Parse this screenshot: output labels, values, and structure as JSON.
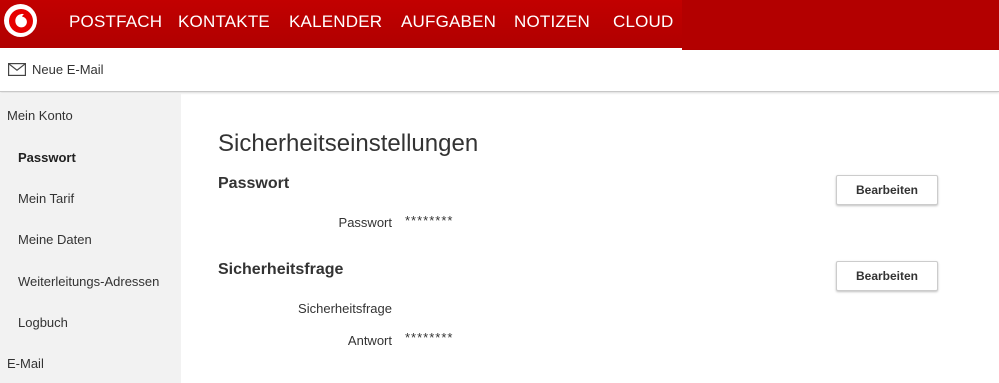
{
  "colors": {
    "brand": "#c00000",
    "sidebar_bg": "#f2f2f2"
  },
  "nav": {
    "items": [
      {
        "id": "postfach",
        "label": "POSTFACH"
      },
      {
        "id": "kontakte",
        "label": "KONTAKTE"
      },
      {
        "id": "kalender",
        "label": "KALENDER"
      },
      {
        "id": "aufgaben",
        "label": "AUFGABEN"
      },
      {
        "id": "notizen",
        "label": "NOTIZEN"
      },
      {
        "id": "cloud",
        "label": "CLOUD"
      }
    ]
  },
  "toolbar": {
    "compose_label": "Neue E-Mail",
    "compose_icon": "envelope-icon"
  },
  "sidebar": {
    "items": [
      {
        "label": "Mein Konto",
        "level": 0
      },
      {
        "label": "Passwort",
        "level": 1,
        "active": true
      },
      {
        "label": "Mein Tarif",
        "level": 1
      },
      {
        "label": "Meine Daten",
        "level": 1
      },
      {
        "label": "Weiterleitungs-Adressen",
        "level": 1
      },
      {
        "label": "Logbuch",
        "level": 1
      },
      {
        "label": "E-Mail",
        "level": 0
      }
    ]
  },
  "main": {
    "title": "Sicherheitseinstellungen",
    "sections": [
      {
        "title": "Passwort",
        "button": "Bearbeiten",
        "fields": [
          {
            "label": "Passwort",
            "value": "********"
          }
        ]
      },
      {
        "title": "Sicherheitsfrage",
        "button": "Bearbeiten",
        "fields": [
          {
            "label": "Sicherheitsfrage",
            "value": ""
          },
          {
            "label": "Antwort",
            "value": "********"
          }
        ]
      }
    ]
  }
}
